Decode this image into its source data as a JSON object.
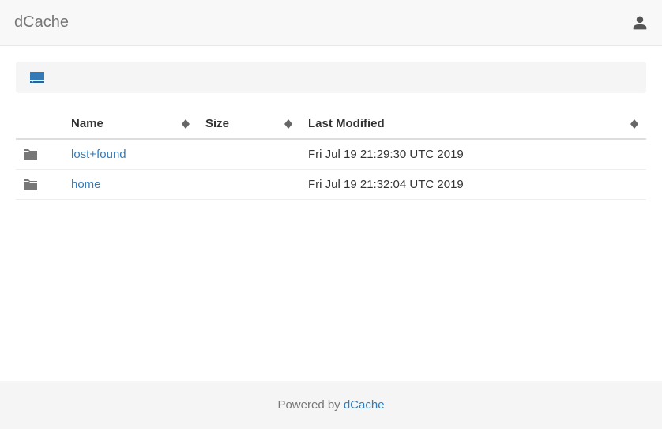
{
  "navbar": {
    "brand": "dCache"
  },
  "columns": {
    "name": "Name",
    "size": "Size",
    "last_modified": "Last Modified"
  },
  "rows": [
    {
      "type": "folder",
      "name": "lost+found",
      "size": "",
      "last_modified": "Fri Jul 19 21:29:30 UTC 2019"
    },
    {
      "type": "folder",
      "name": "home",
      "size": "",
      "last_modified": "Fri Jul 19 21:32:04 UTC 2019"
    }
  ],
  "footer": {
    "text": "Powered by ",
    "link_text": "dCache"
  }
}
